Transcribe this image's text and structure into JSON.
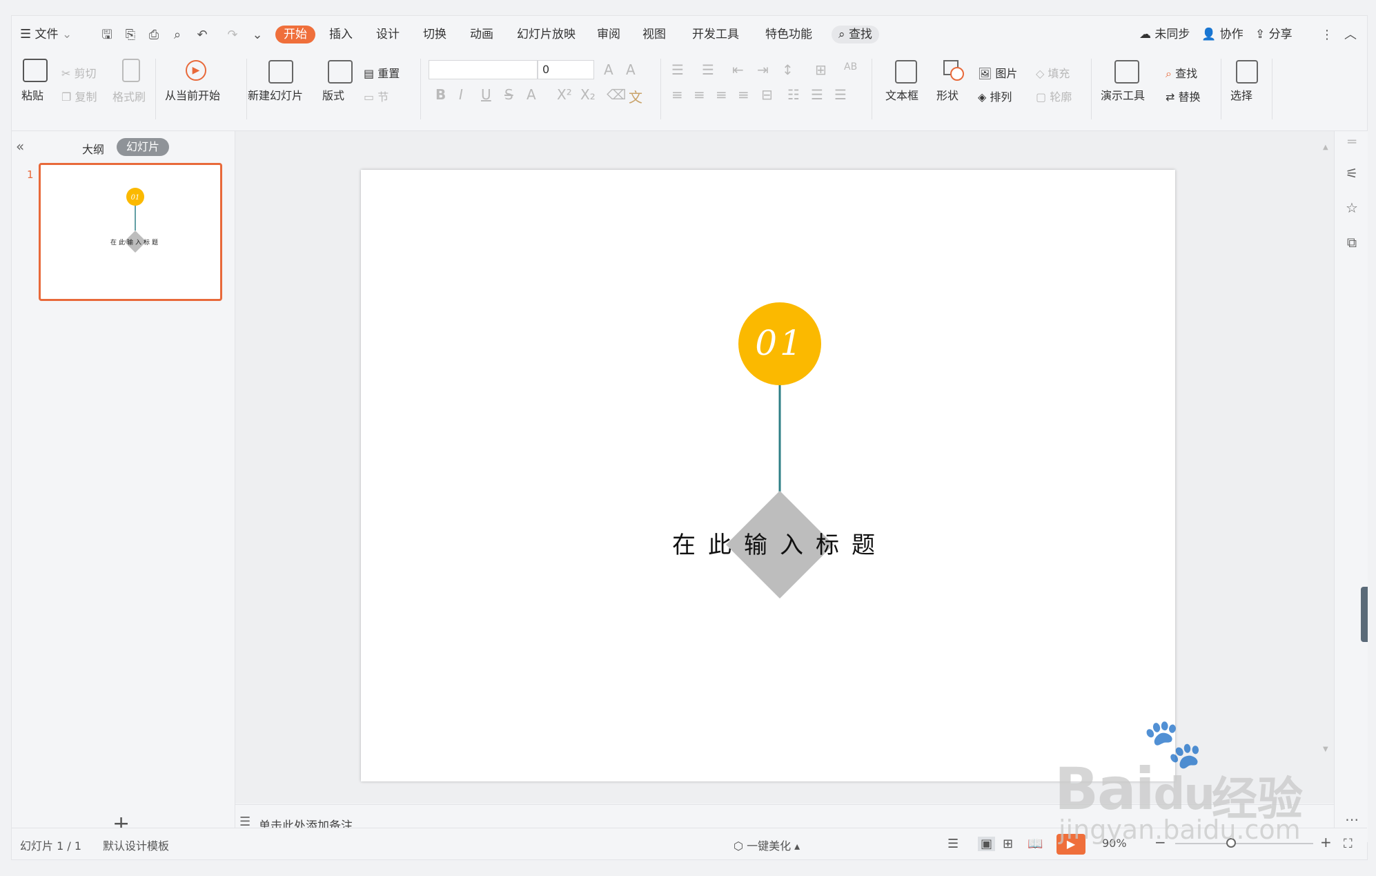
{
  "menu": {
    "file": "文件",
    "tabs": [
      "开始",
      "插入",
      "设计",
      "切换",
      "动画",
      "幻灯片放映",
      "审阅",
      "视图",
      "开发工具",
      "特色功能"
    ],
    "active_tab": "开始",
    "search": "查找",
    "right": {
      "sync": "未同步",
      "collab": "协作",
      "share": "分享"
    }
  },
  "ribbon": {
    "paste": "粘贴",
    "cut": "剪切",
    "copy": "复制",
    "format_painter": "格式刷",
    "from_current": "从当前开始",
    "new_slide": "新建幻灯片",
    "layout": "版式",
    "reset": "重置",
    "section": "节",
    "font_size": "0",
    "textbox": "文本框",
    "shape": "形状",
    "picture": "图片",
    "fill": "填充",
    "arrange": "排列",
    "outline": "轮廓",
    "present_tools": "演示工具",
    "find": "查找",
    "replace": "替换",
    "select": "选择"
  },
  "panel": {
    "outline_tab": "大纲",
    "slides_tab": "幻灯片",
    "slide_number": "1"
  },
  "slide": {
    "badge_number": "01",
    "title": "在此输入标题",
    "badge_color": "#fbb900",
    "line_color": "#2d7f86",
    "diamond_color": "#bdbdbd"
  },
  "notes": {
    "placeholder": "单击此处添加备注"
  },
  "status": {
    "slide_count": "幻灯片 1 / 1",
    "template": "默认设计模板",
    "beautify": "一键美化",
    "zoom": "90%"
  },
  "watermark": {
    "brand": "Bai",
    "suffix": "经验",
    "url": "jingyan.baidu.com"
  }
}
